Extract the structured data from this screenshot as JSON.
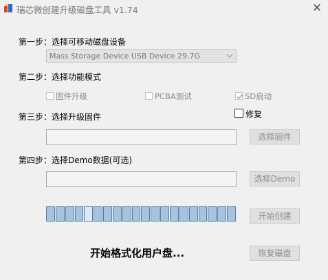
{
  "window": {
    "title": "瑞芯微创建升级磁盘工具 v1.74",
    "close_glyph": "✕"
  },
  "step1": {
    "label": "第一步：选择可移动磁盘设备",
    "device": "Mass Storage Device USB Device   29.7G"
  },
  "step2": {
    "label": "第二步：选择功能模式",
    "options": [
      {
        "label": "固件升级",
        "checked": false
      },
      {
        "label": "PCBA测试",
        "checked": false
      },
      {
        "label": "SD启动",
        "checked": true
      }
    ]
  },
  "repair": {
    "label": "修复",
    "checked": false
  },
  "step3": {
    "label": "第三步：选择升级固件",
    "button": "选择固件"
  },
  "step4": {
    "label": "第四步：选择Demo数据(可选)",
    "button": "选择Demo"
  },
  "create_button": "开始创建",
  "restore_button": "恢复磁盘",
  "progress": {
    "total_segments": 20,
    "active_segment": 5
  },
  "status": "开始格式化用户盘..."
}
